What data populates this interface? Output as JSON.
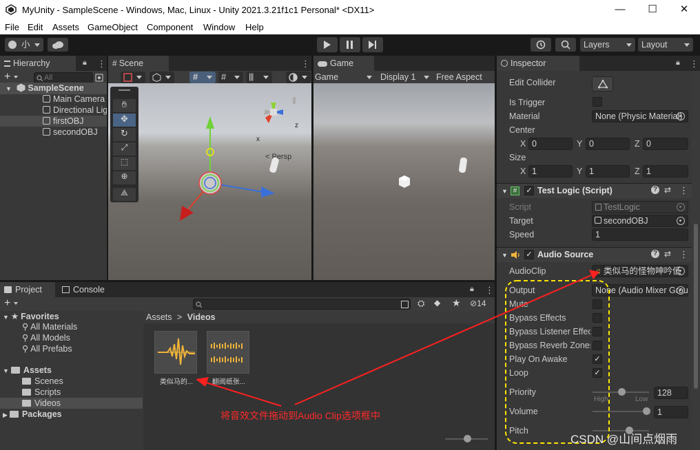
{
  "window": {
    "title": "MyUnity - SampleScene - Windows, Mac, Linux - Unity 2021.3.21f1c1 Personal* <DX11>",
    "minimize": "—",
    "maximize": "☐",
    "close": "✕"
  },
  "menu": [
    "File",
    "Edit",
    "Assets",
    "GameObject",
    "Component",
    "Window",
    "Help"
  ],
  "toolbar": {
    "account_label": "小",
    "layers_label": "Layers",
    "layout_label": "Layout"
  },
  "hierarchy": {
    "tab_label": "Hierarchy",
    "search_placeholder": "All",
    "scene_name": "SampleScene",
    "items": [
      "Main Camera",
      "Directional Light",
      "firstOBJ",
      "secondOBJ"
    ]
  },
  "scene": {
    "tab_label": "Scene",
    "persp_label": "< Persp",
    "axis_x": "x",
    "axis_z": "z",
    "axis_y": "y"
  },
  "game": {
    "tab_label": "Game",
    "mode_label": "Game",
    "display_label": "Display 1",
    "aspect_label": "Free Aspect"
  },
  "inspector": {
    "tab_label": "Inspector",
    "collider": {
      "edit_collider_label": "Edit Collider",
      "is_trigger_label": "Is Trigger",
      "material_label": "Material",
      "material_value": "None (Physic Material)",
      "center_label": "Center",
      "center": {
        "x": "0",
        "y": "0",
        "z": "0"
      },
      "size_label": "Size",
      "size": {
        "x": "1",
        "y": "1",
        "z": "1"
      },
      "x_label": "X",
      "y_label": "Y",
      "z_label": "Z"
    },
    "test_logic": {
      "title": "Test Logic (Script)",
      "script_label": "Script",
      "script_value": "TestLogic",
      "target_label": "Target",
      "target_value": "secondOBJ",
      "speed_label": "Speed",
      "speed_value": "1"
    },
    "audio_source": {
      "title": "Audio Source",
      "audioclip_label": "AudioClip",
      "audioclip_value": "类似马的怪物呻吟低",
      "output_label": "Output",
      "output_value": "None (Audio Mixer Group)",
      "mute_label": "Mute",
      "bypass_effects_label": "Bypass Effects",
      "bypass_listener_label": "Bypass Listener Effects",
      "bypass_reverb_label": "Bypass Reverb Zones",
      "play_on_awake_label": "Play On Awake",
      "loop_label": "Loop",
      "priority_label": "Priority",
      "priority_value": "128",
      "priority_high": "High",
      "priority_low": "Low",
      "volume_label": "Volume",
      "volume_value": "1",
      "pitch_label": "Pitch",
      "mute": false,
      "bypass_effects": false,
      "bypass_listener": false,
      "bypass_reverb": false,
      "play_on_awake": true,
      "loop": true,
      "check_mark": "✓"
    }
  },
  "project": {
    "tab_project": "Project",
    "tab_console": "Console",
    "hidden_count": "14",
    "favorites_label": "Favorites",
    "favorites": [
      "All Materials",
      "All Models",
      "All Prefabs"
    ],
    "assets_label": "Assets",
    "asset_folders": [
      "Scenes",
      "Scripts",
      "Videos"
    ],
    "packages_label": "Packages",
    "breadcrumb_root": "Assets",
    "breadcrumb_sep": ">",
    "breadcrumb_current": "Videos",
    "files": [
      "类似马的...",
      "翻阅纸张..."
    ]
  },
  "annotation": {
    "text": "将音效文件拖动到Audio Clip选项框中",
    "color": "#ff2020",
    "box_color": "#ffe600"
  },
  "watermark": "CSDN @山间点烟雨"
}
